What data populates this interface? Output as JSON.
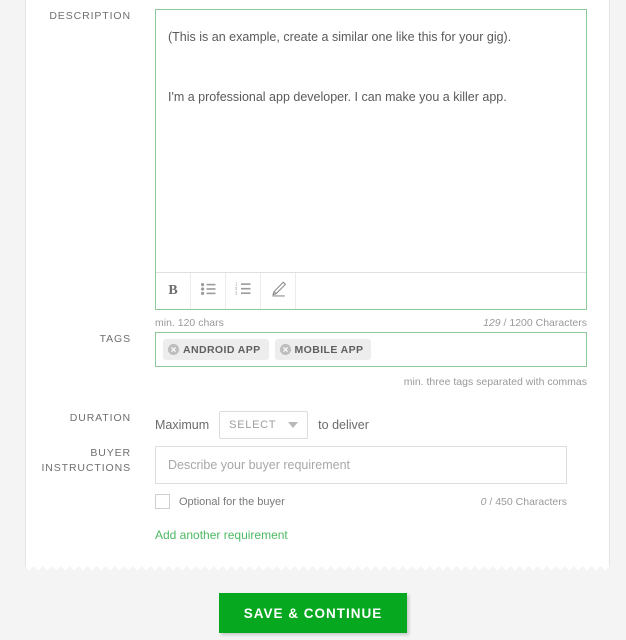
{
  "description": {
    "label": "DESCRIPTION",
    "value": "(This is an example, create a similar one like this for your gig).\n\nI'm a professional app developer. I can make you a killer app.",
    "placeholder": "",
    "toolbar": {
      "bold_label": "B",
      "bold_name": "bold",
      "bullet_list_name": "bullet-list",
      "numbered_list_name": "numbered-list",
      "highlighter_name": "highlighter"
    },
    "helper_left": "min. 120 chars",
    "counter_current": "129",
    "counter_rest": " / 1200 Characters"
  },
  "tags": {
    "label": "TAGS",
    "items": [
      {
        "label": "ANDROID APP"
      },
      {
        "label": "MOBILE APP"
      }
    ],
    "helper": "min. three tags separated with commas"
  },
  "duration": {
    "label": "DURATION",
    "prefix": "Maximum",
    "select_value": "SELECT",
    "suffix": "to deliver"
  },
  "buyer_instructions": {
    "label_line1": "BUYER",
    "label_line2": "INSTRUCTIONS",
    "input_value": "",
    "input_placeholder": "Describe your buyer requirement",
    "optional_label": "Optional for the buyer",
    "counter_current": "0",
    "counter_rest": " / 450 Characters",
    "add_link": "Add another requirement"
  },
  "footer": {
    "save_label": "SAVE & CONTINUE"
  },
  "colors": {
    "accent_green": "#05a81f",
    "link_green": "#4cb963",
    "field_border_green": "#8ec99a",
    "page_background": "#f4f4f4"
  }
}
